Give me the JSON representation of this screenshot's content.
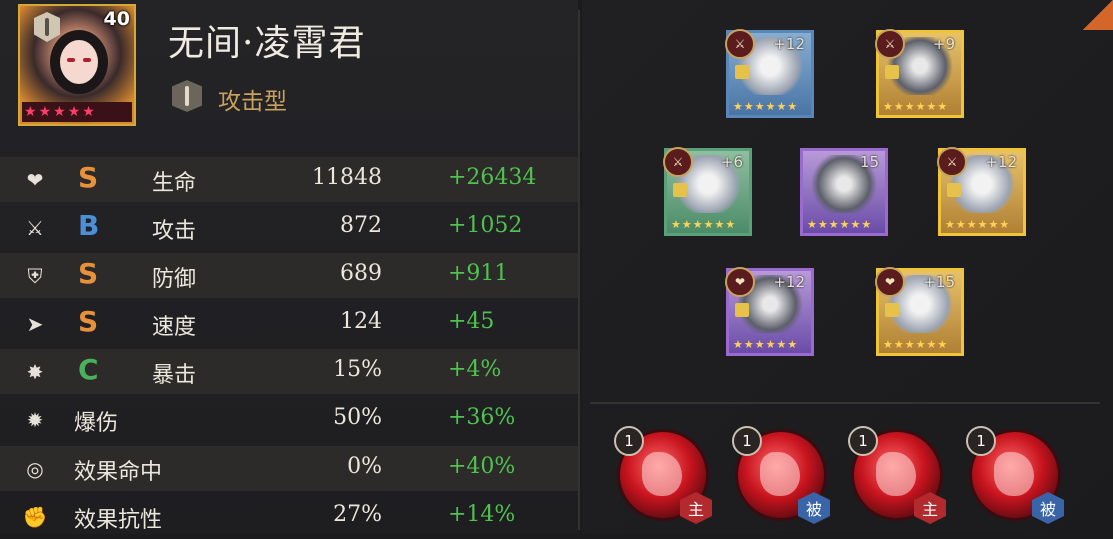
{
  "hero": {
    "name": "无间·凌霄君",
    "level": "40",
    "type": "攻击型",
    "stars": 5,
    "star_char": "★",
    "icon": "sword-icon"
  },
  "stats": [
    {
      "icon": "heart-icon",
      "glyph": "❤",
      "grade": "S",
      "grade_color": "#e8913a",
      "name": "生命",
      "base": "11848",
      "bonus": "+26434"
    },
    {
      "icon": "sword-icon",
      "glyph": "⚔",
      "grade": "B",
      "grade_color": "#4a8fd8",
      "name": "攻击",
      "base": "872",
      "bonus": "+1052"
    },
    {
      "icon": "shield-icon",
      "glyph": "⛨",
      "grade": "S",
      "grade_color": "#e8913a",
      "name": "防御",
      "base": "689",
      "bonus": "+911"
    },
    {
      "icon": "speed-icon",
      "glyph": "➤",
      "grade": "S",
      "grade_color": "#e8913a",
      "name": "速度",
      "base": "124",
      "bonus": "+45"
    },
    {
      "icon": "crit-icon",
      "glyph": "✸",
      "grade": "C",
      "grade_color": "#4bb05a",
      "name": "暴击",
      "base": "15%",
      "bonus": "+4%"
    },
    {
      "icon": "crit-damage-icon",
      "glyph": "✹",
      "grade": "",
      "grade_color": "",
      "name": "爆伤",
      "base": "50%",
      "bonus": "+36%"
    },
    {
      "icon": "target-icon",
      "glyph": "◎",
      "grade": "",
      "grade_color": "",
      "name": "效果命中",
      "base": "0%",
      "bonus": "+40%"
    },
    {
      "icon": "fist-icon",
      "glyph": "✊",
      "grade": "",
      "grade_color": "",
      "name": "效果抗性",
      "base": "27%",
      "bonus": "+14%"
    }
  ],
  "equipment": [
    {
      "name": "weapon-slot",
      "plus": "+12",
      "rarity": "blue",
      "tag": "⚔"
    },
    {
      "name": "armor-slot",
      "plus": "+9",
      "rarity": "gold",
      "tag": "⚔"
    },
    {
      "name": "helmet-slot",
      "plus": "+6",
      "rarity": "green",
      "tag": "⚔"
    },
    {
      "name": "artifact-slot",
      "plus": "15",
      "rarity": "purple",
      "tag": ""
    },
    {
      "name": "boots-slot",
      "plus": "+12",
      "rarity": "gold",
      "tag": "⚔"
    },
    {
      "name": "ring-slot",
      "plus": "+12",
      "rarity": "purple",
      "tag": "❤"
    },
    {
      "name": "necklace-slot",
      "plus": "+15",
      "rarity": "gold",
      "tag": "❤"
    }
  ],
  "equip_star_char": "★",
  "skills": [
    {
      "level": "1",
      "type": "主",
      "type_color": "red"
    },
    {
      "level": "1",
      "type": "被",
      "type_color": "blue"
    },
    {
      "level": "1",
      "type": "主",
      "type_color": "red"
    },
    {
      "level": "1",
      "type": "被",
      "type_color": "blue"
    }
  ]
}
